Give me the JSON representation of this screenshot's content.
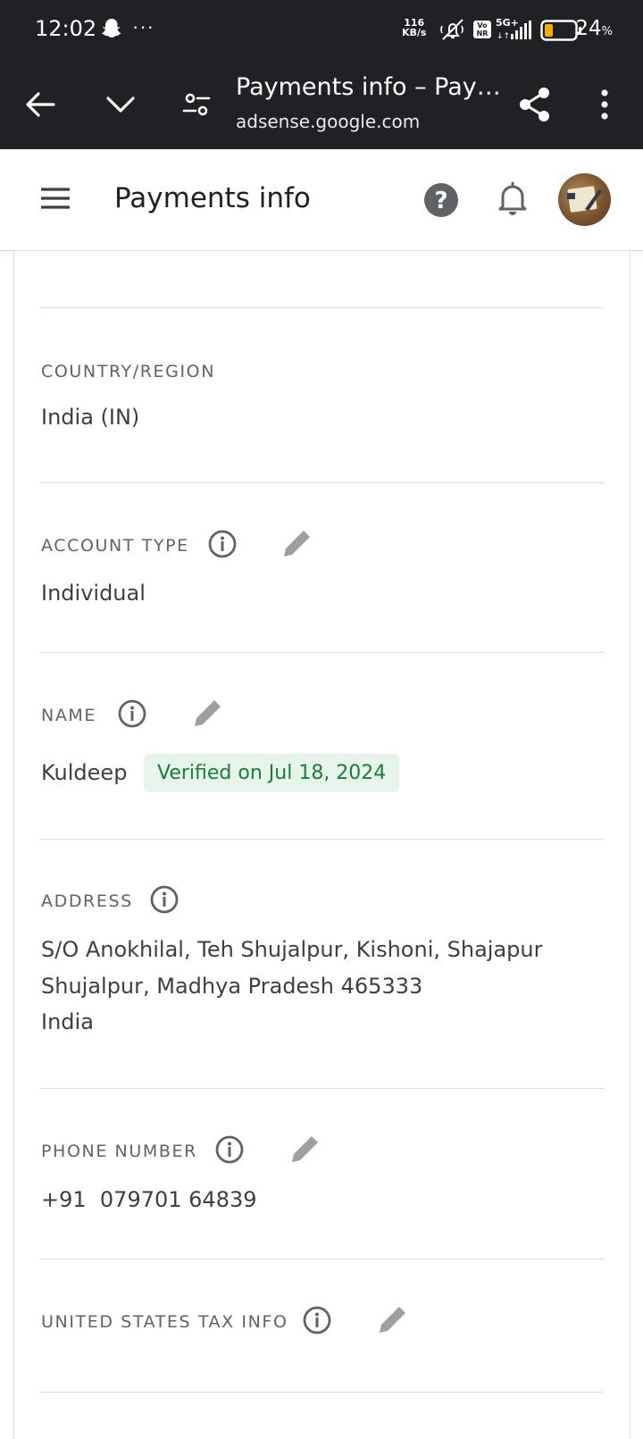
{
  "status_bar": {
    "time": "12:02",
    "more": "···",
    "net_speed_value": "116",
    "net_speed_unit": "KB/s",
    "network": "5G+",
    "volte": "Vo NR",
    "battery_percent": "24",
    "battery_symbol": "%"
  },
  "browser": {
    "tab_title": "Payments info – Pay…",
    "domain": "adsense.google.com"
  },
  "header": {
    "title": "Payments info"
  },
  "fields": {
    "country": {
      "label": "COUNTRY/REGION",
      "value": "India (IN)"
    },
    "account_type": {
      "label": "ACCOUNT TYPE",
      "value": "Individual"
    },
    "name": {
      "label": "NAME",
      "value": "Kuldeep",
      "badge": "Verified on Jul 18, 2024"
    },
    "address": {
      "label": "ADDRESS",
      "lines": [
        "S/O Anokhilal, Teh Shujalpur, Kishoni, Shajapur",
        "Shujalpur, Madhya Pradesh 465333",
        "India"
      ]
    },
    "phone": {
      "label": "PHONE NUMBER",
      "value": "+91  079701 64839"
    },
    "us_tax": {
      "label": "UNITED STATES TAX INFO"
    }
  },
  "colors": {
    "chrome_bg": "#202124",
    "badge_bg": "#e6f4ea",
    "badge_text": "#188038",
    "label": "#5f6368",
    "icon_grey": "#9e9e9e",
    "battery_fill": "#f9ab00"
  },
  "icons": [
    "snapchat-ghost-icon",
    "back-arrow-icon",
    "chevron-down-icon",
    "tune-icon",
    "share-icon",
    "more-vert-icon",
    "menu-icon",
    "help-icon",
    "bell-icon",
    "info-icon",
    "edit-pencil-icon"
  ]
}
